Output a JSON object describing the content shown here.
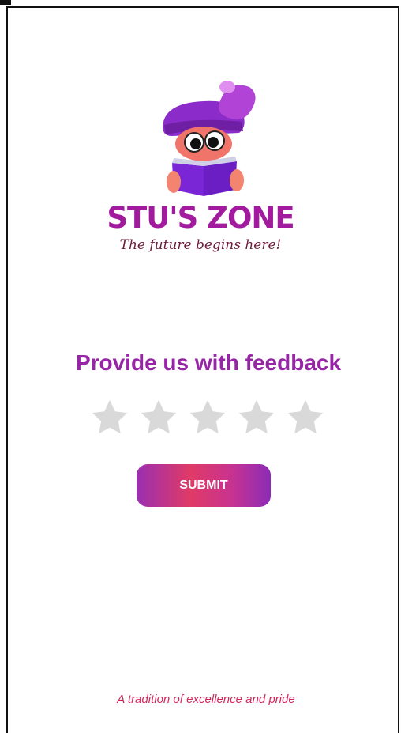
{
  "brand": {
    "name": "STU'S ZONE",
    "tagline": "The future begins here!"
  },
  "feedback": {
    "heading": "Provide us with feedback",
    "rating": 0,
    "max_rating": 5,
    "star_color": "#d9d9d9",
    "submit_label": "SUBMIT"
  },
  "footer": {
    "text": "A tradition of excellence and pride"
  },
  "colors": {
    "accent": "#9726a6",
    "brand": "#a21a9e",
    "footer": "#d6265c"
  }
}
